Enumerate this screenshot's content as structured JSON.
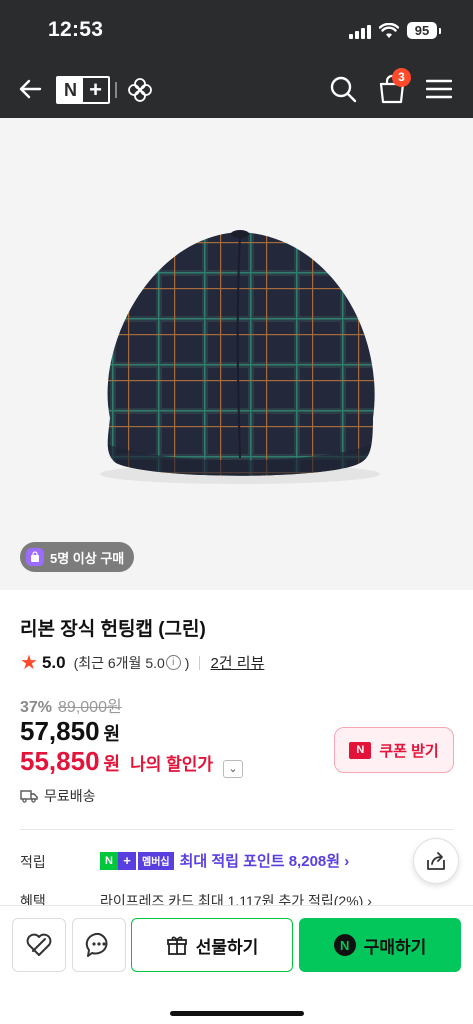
{
  "status_bar": {
    "time": "12:53",
    "battery": "95"
  },
  "header": {
    "logo_n": "N",
    "logo_plus": "+",
    "cart_count": "3"
  },
  "product": {
    "purchase_badge": "5명 이상 구매",
    "title": "리본 장식 헌팅캡 (그린)",
    "rating": {
      "score": "5.0",
      "recent_text": "(최근 6개월 5.0",
      "info_glyph": "i",
      "recent_close": ")",
      "reviews": "2건 리뷰"
    },
    "price": {
      "discount_rate": "37%",
      "original": "89,000원",
      "sale": "57,850",
      "sale_unit": "원",
      "my_price": "55,850",
      "my_unit": "원",
      "my_label": "나의 할인가"
    },
    "coupon_label": "쿠폰 받기",
    "coupon_icon_letter": "N",
    "shipping": "무료배송"
  },
  "points": {
    "label": "적립",
    "badge_n": "N",
    "badge_plus": "+",
    "badge_text": "멤버십",
    "text": "최대 적립 포인트 8,208원 ›"
  },
  "benefit": {
    "label": "혜택",
    "text": "라이프레즈 카드 최대 1,117원 추가 적립(2%) ›"
  },
  "bottom_bar": {
    "gift_label": "선물하기",
    "buy_label": "구매하기",
    "buy_icon_letter": "N"
  },
  "colors": {
    "header_bg": "#2b2c2e",
    "accent_red": "#e3133a",
    "accent_green": "#03c75a",
    "accent_purple": "#5a3fe0",
    "cart_badge": "#ff4b2b"
  }
}
